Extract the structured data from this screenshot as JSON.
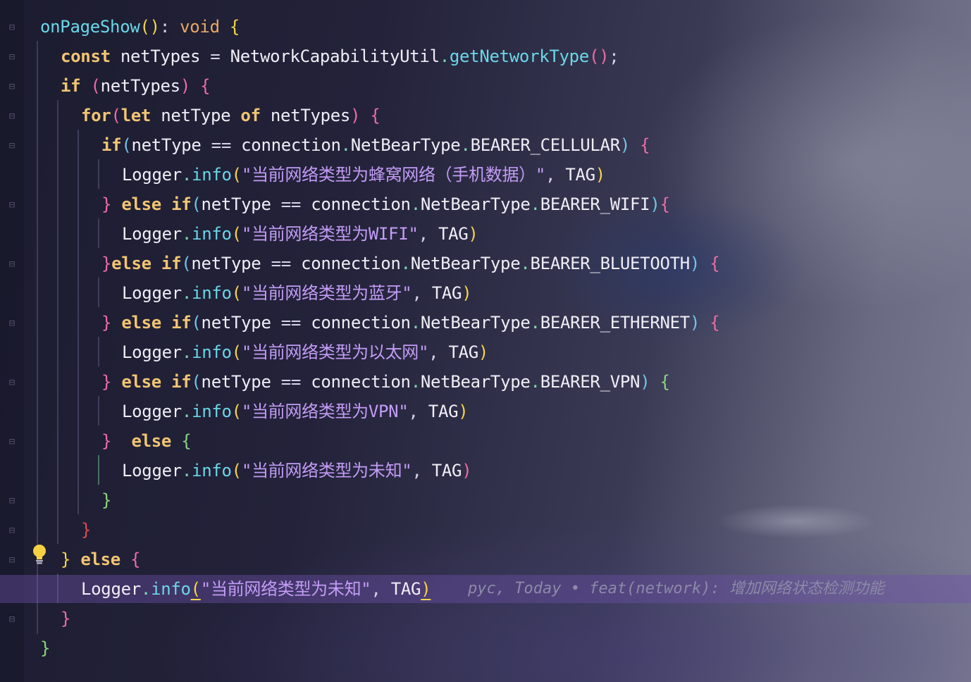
{
  "editor": {
    "code": {
      "l1": {
        "fn": "onPageShow",
        "colon": ":",
        "type": "void"
      },
      "l2": {
        "kw": "const",
        "var": "netTypes",
        "eq": "=",
        "cls": "NetworkCapabilityUtil",
        "method": "getNetworkType"
      },
      "l3": {
        "kw": "if",
        "var": "netTypes"
      },
      "l4": {
        "kw_for": "for",
        "kw_let": "let",
        "var": "netType",
        "kw_of": "of",
        "iter": "netTypes"
      },
      "l5": {
        "kw": "if",
        "var": "netType",
        "op": "==",
        "ns": "connection",
        "enum": "NetBearType",
        "member": "BEARER_CELLULAR"
      },
      "l6": {
        "obj": "Logger",
        "method": "info",
        "msg": "\"当前网络类型为蜂窝网络（手机数据）\"",
        "tag": "TAG"
      },
      "l7": {
        "kw_else": "else",
        "kw_if": "if",
        "var": "netType",
        "op": "==",
        "ns": "connection",
        "enum": "NetBearType",
        "member": "BEARER_WIFI"
      },
      "l8": {
        "obj": "Logger",
        "method": "info",
        "msg": "\"当前网络类型为WIFI\"",
        "tag": "TAG"
      },
      "l9": {
        "kw_else": "else",
        "kw_if": "if",
        "var": "netType",
        "op": "==",
        "ns": "connection",
        "enum": "NetBearType",
        "member": "BEARER_BLUETOOTH"
      },
      "l10": {
        "obj": "Logger",
        "method": "info",
        "msg": "\"当前网络类型为蓝牙\"",
        "tag": "TAG"
      },
      "l11": {
        "kw_else": "else",
        "kw_if": "if",
        "var": "netType",
        "op": "==",
        "ns": "connection",
        "enum": "NetBearType",
        "member": "BEARER_ETHERNET"
      },
      "l12": {
        "obj": "Logger",
        "method": "info",
        "msg": "\"当前网络类型为以太网\"",
        "tag": "TAG"
      },
      "l13": {
        "kw_else": "else",
        "kw_if": "if",
        "var": "netType",
        "op": "==",
        "ns": "connection",
        "enum": "NetBearType",
        "member": "BEARER_VPN"
      },
      "l14": {
        "obj": "Logger",
        "method": "info",
        "msg": "\"当前网络类型为VPN\"",
        "tag": "TAG"
      },
      "l15": {
        "kw_else": "else"
      },
      "l16": {
        "obj": "Logger",
        "method": "info",
        "msg": "\"当前网络类型为未知\"",
        "tag": "TAG"
      },
      "l19": {
        "kw_else": "else"
      },
      "l20": {
        "obj": "Logger",
        "method": "info",
        "msg": "\"当前网络类型为未知\"",
        "tag": "TAG"
      }
    },
    "blame": "pyc, Today • feat(network): 增加网络状态检测功能",
    "colors": {
      "keyword": "#f2c572",
      "function": "#6ad7e8",
      "string": "#c39cf6",
      "bracket_1": "#f7d44a",
      "bracket_2": "#ef6ba6",
      "bracket_3": "#6fc6e8",
      "bracket_4": "#8ad67c",
      "current_line": "#5b3f8f"
    },
    "icons": [
      "fold-marker-icon",
      "lightbulb-icon"
    ]
  }
}
